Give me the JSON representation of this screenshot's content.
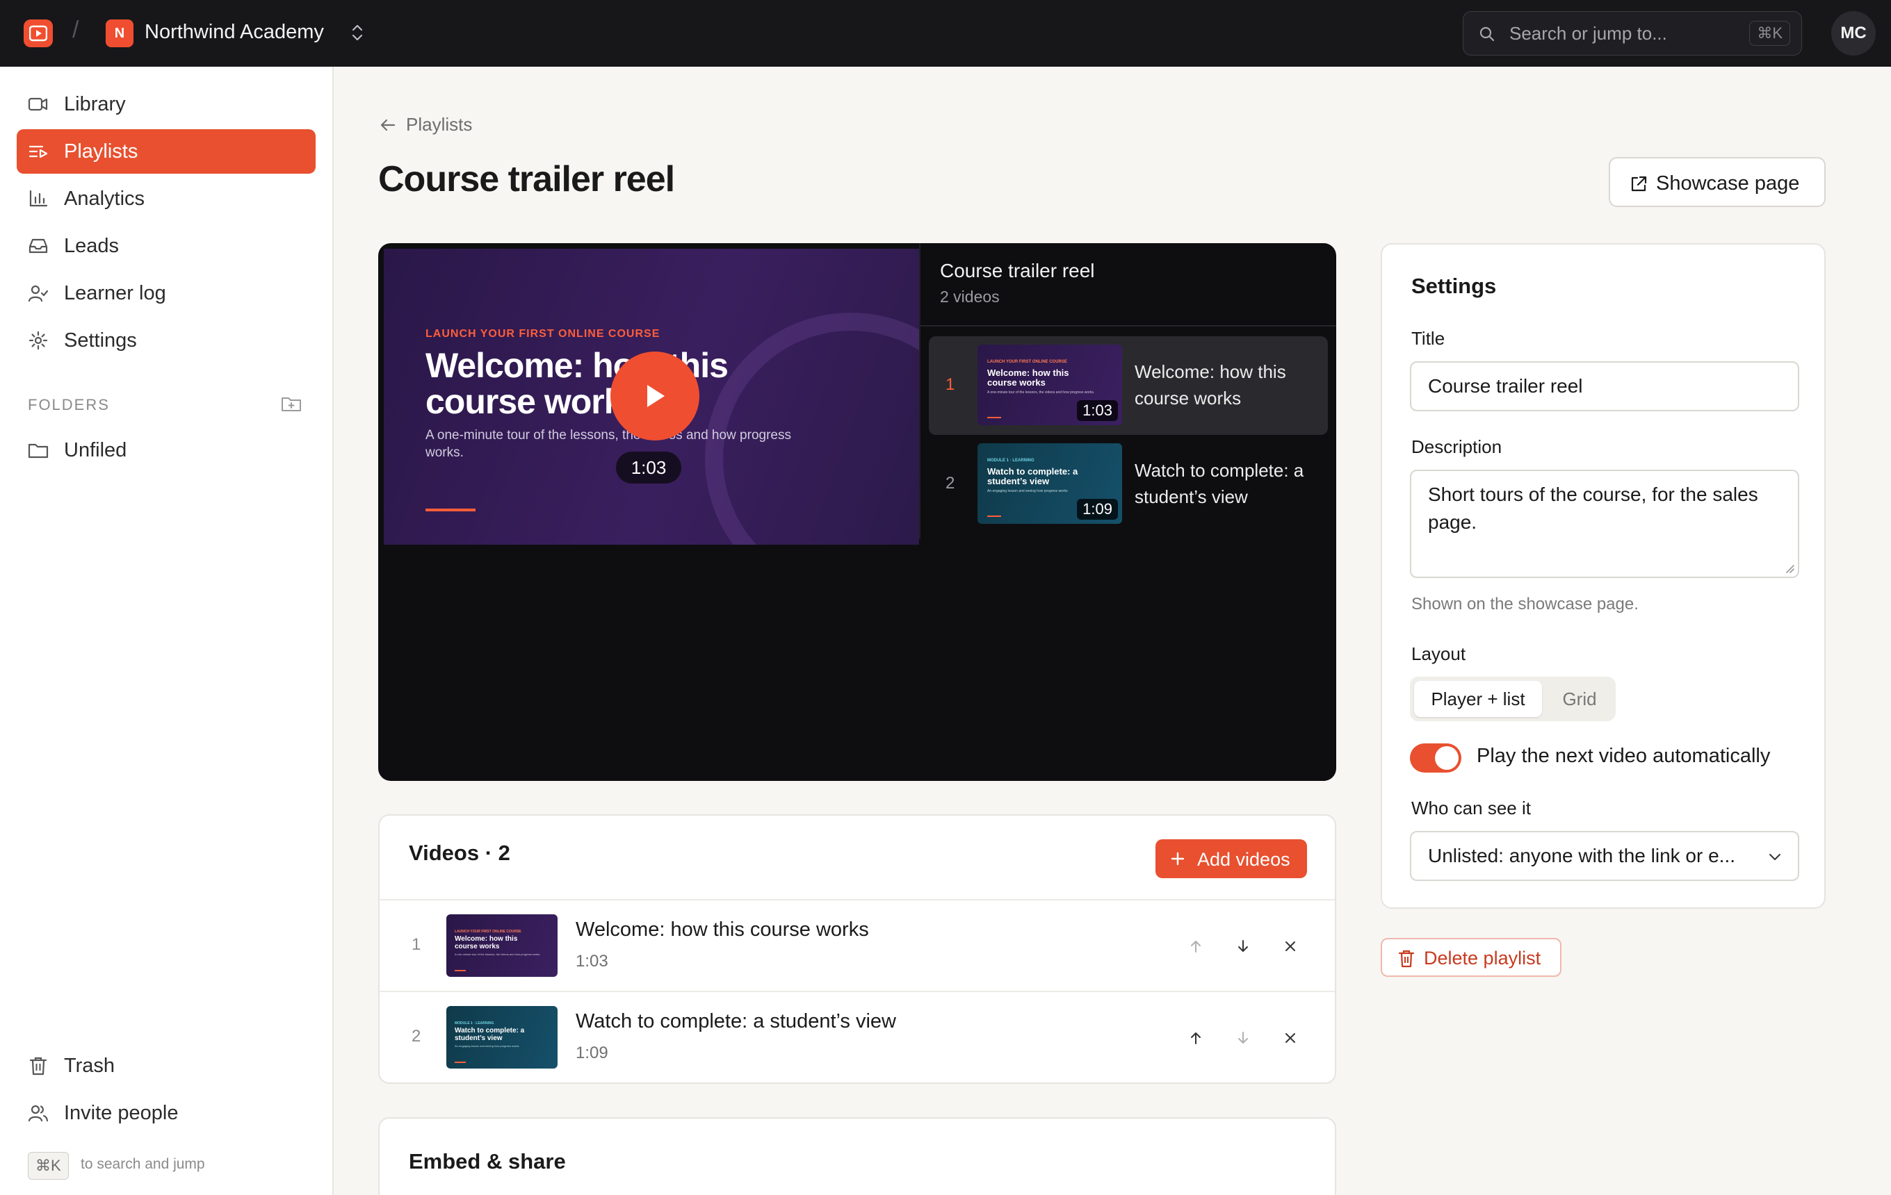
{
  "topbar": {
    "workspace_initial": "N",
    "workspace_name": "Northwind Academy",
    "separator": "/",
    "search_placeholder": "Search or jump to...",
    "search_shortcut": "⌘K",
    "avatar_initials": "MC"
  },
  "sidebar": {
    "items": [
      {
        "label": "Library",
        "icon": "video-camera-icon"
      },
      {
        "label": "Playlists",
        "icon": "playlist-icon",
        "active": true
      },
      {
        "label": "Analytics",
        "icon": "bar-chart-icon"
      },
      {
        "label": "Leads",
        "icon": "inbox-icon"
      },
      {
        "label": "Learner log",
        "icon": "user-check-icon"
      },
      {
        "label": "Settings",
        "icon": "gear-icon"
      }
    ],
    "folders_heading": "FOLDERS",
    "folders": [
      {
        "label": "Unfiled",
        "icon": "folder-icon"
      }
    ],
    "bottom_items": [
      {
        "label": "Trash",
        "icon": "trash-icon"
      },
      {
        "label": "Invite people",
        "icon": "users-icon"
      }
    ],
    "shortcut_key": "⌘K",
    "shortcut_hint": "to search and jump"
  },
  "header": {
    "back_label": "Playlists",
    "title": "Course trailer reel",
    "showcase_button": "Showcase page"
  },
  "player": {
    "slide": {
      "eyebrow": "LAUNCH YOUR FIRST ONLINE COURSE",
      "title": "Welcome: how this course works",
      "subtitle": "A one-minute tour of the lessons, the videos and how progress works."
    },
    "duration": "1:03",
    "playlist_title": "Course trailer reel",
    "playlist_count": "2 videos",
    "items": [
      {
        "number": "1",
        "title": "Welcome: how this course works",
        "duration": "1:03",
        "thumb_eyebrow": "LAUNCH YOUR FIRST ONLINE COURSE",
        "thumb_title": "Welcome: how this course works",
        "thumb_sub": "A one-minute tour of the lessons, the videos and how progress works."
      },
      {
        "number": "2",
        "title": "Watch to complete: a student’s view",
        "duration": "1:09",
        "thumb_eyebrow": "MODULE 1 · LEARNING",
        "thumb_title": "Watch to complete: a student’s view",
        "thumb_sub": "An engaging lesson and seeing how progress works"
      }
    ]
  },
  "videos": {
    "heading": "Videos · 2",
    "add_button": "Add videos",
    "rows": [
      {
        "number": "1",
        "title": "Welcome: how this course works",
        "duration": "1:03"
      },
      {
        "number": "2",
        "title": "Watch to complete: a student’s view",
        "duration": "1:09"
      }
    ]
  },
  "embed": {
    "heading": "Embed & share"
  },
  "settings": {
    "heading": "Settings",
    "title_label": "Title",
    "title_value": "Course trailer reel",
    "description_label": "Description",
    "description_value": "Short tours of the course, for the sales page.",
    "description_help": "Shown on the showcase page.",
    "layout_label": "Layout",
    "layout_options": [
      "Player + list",
      "Grid"
    ],
    "layout_selected": "Player + list",
    "autoplay_label": "Play the next video automatically",
    "autoplay_on": true,
    "visibility_label": "Who can see it",
    "visibility_value": "Unlisted: anyone with the link or e..."
  },
  "delete_button": "Delete playlist",
  "colors": {
    "accent": "#e8502f",
    "topbar_bg": "#17171a",
    "player_bg": "#0e0e10",
    "page_bg": "#f7f6f3"
  }
}
